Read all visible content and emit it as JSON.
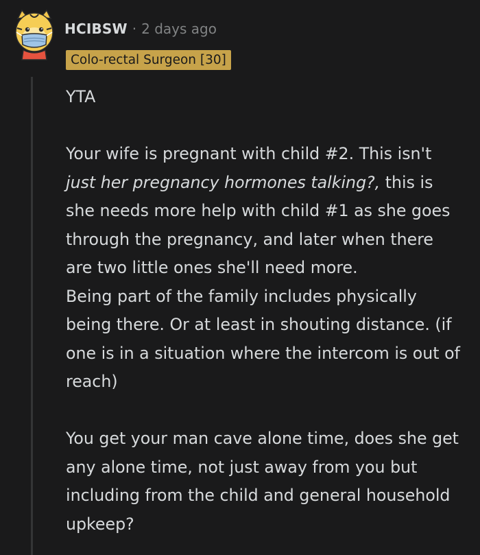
{
  "comment": {
    "username": "HCIBSW",
    "separator": "·",
    "timestamp": "2 days ago",
    "flair": "Colo-rectal Surgeon [30]",
    "paragraph_1": "YTA",
    "p2_part1": "Your wife is pregnant with child #2. This isn't ",
    "p2_italic": "just her pregnancy hormones talking?,",
    "p2_part2": " this is she needs more help with child #1 as she goes through the pregnancy, and later when there are two little ones she'll need more.",
    "paragraph_3": "Being part of the family includes physically being there. Or at least in shouting distance. (if one is in a situation where the intercom is out of reach)",
    "paragraph_4": "You get your man cave alone time, does she get any alone time, not just away from you but including from the child and general household upkeep?"
  },
  "colors": {
    "background": "#1a1a1b",
    "text": "#d7dadc",
    "meta": "#818384",
    "flair_bg": "#c7a34a",
    "thread_line": "#343536"
  },
  "icons": {
    "avatar": "yellow-animal-avatar-with-mask"
  }
}
